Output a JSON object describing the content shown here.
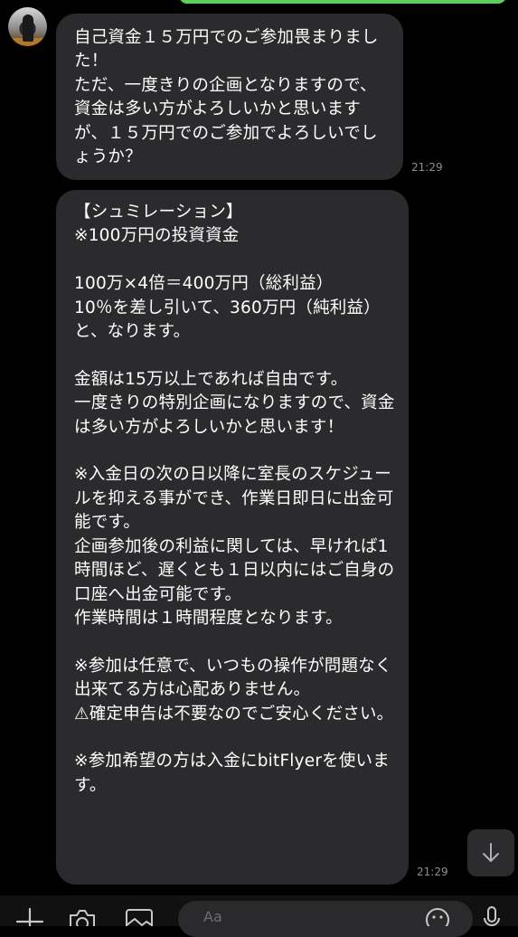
{
  "messages": [
    {
      "text": "自己資金１５万円でのご参加畏まりました！\nただ、一度きりの企画となりますので、資金は多い方がよろしいかと思いますが、１５万円でのご参加でよろしいでしょうか？",
      "time": "21:29"
    },
    {
      "text": "【シュミレーション】\n※100万円の投資資金\n\n100万×4倍＝400万円（総利益）\n10％を差し引いて、360万円（純利益）と、なります。\n\n金額は15万以上であれば自由です。\n一度きりの特別企画になりますので、資金は多い方がよろしいかと思います！\n\n※入金日の次の日以降に室長のスケジュールを抑える事ができ、作業日即日に出金可能です。\n企画参加後の利益に関しては、早ければ1時間ほど、遅くとも１日以内にはご自身の口座へ出金可能です。\n作業時間は１時間程度となります。\n\n※参加は任意で、いつもの操作が問題なく出来てる方は心配ありません。\n⚠確定申告は不要なのでご安心ください。\n\n※参加希望の方は入金にbitFlyerを使います。",
      "time": "21:29"
    }
  ],
  "input": {
    "placeholder": "Aa"
  },
  "icons": {
    "scroll_down": "arrow-down-icon",
    "plus": "plus-icon",
    "camera": "camera-icon",
    "image": "image-icon",
    "emoji": "emoji-icon",
    "mic": "microphone-icon"
  },
  "colors": {
    "background": "#000000",
    "bubble": "#2b2b2d",
    "own_bubble": "#5ad15a",
    "timestamp": "#8e8e93"
  }
}
